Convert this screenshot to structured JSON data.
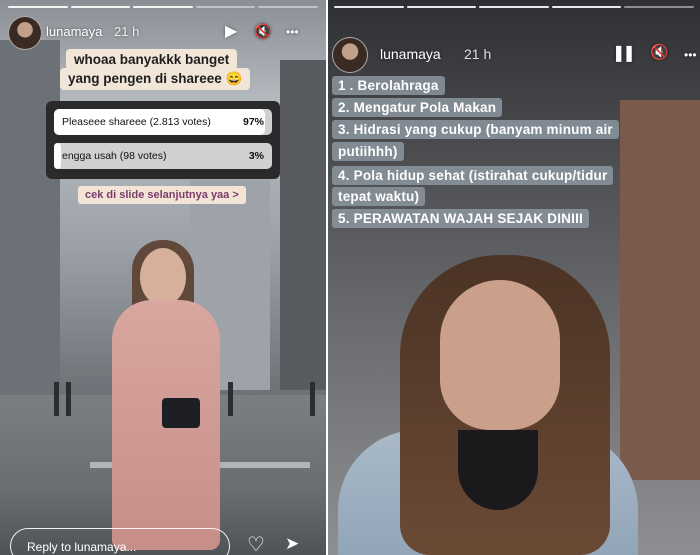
{
  "left_story": {
    "username": "lunamaya",
    "time": "21 h",
    "caption_line1": "whoaa banyakkk banget",
    "caption_line2": "yang pengen di shareee 😄",
    "poll": {
      "options": [
        {
          "label": "Pleaseee shareee (2.813 votes)",
          "percent_text": "97%",
          "percent": 97
        },
        {
          "label": "engga usah (98 votes)",
          "percent_text": "3%",
          "percent": 3
        }
      ]
    },
    "next_slide_text": "cek di slide selanjutnya yaa >",
    "reply_placeholder": "Reply to lunamaya..."
  },
  "right_story": {
    "username": "lunamaya",
    "time": "21 h",
    "list": [
      "1 . Berolahraga",
      "2. Mengatur Pola Makan",
      "3. Hidrasi yang cukup (banyam minum air",
      "putiihhh)",
      "4. Pola hidup sehat (istirahat cukup/tidur",
      "tepat waktu)",
      "5. PERAWATAN WAJAH SEJAK DINIII"
    ]
  },
  "icons": {
    "play": "▶",
    "pause": "❚❚",
    "mute": "🔇",
    "more": "•••",
    "heart": "♡",
    "send": "➤"
  }
}
